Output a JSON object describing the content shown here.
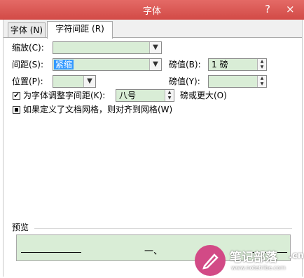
{
  "window": {
    "title": "字体",
    "help": "?",
    "close": "×"
  },
  "tabs": [
    {
      "label": "字体 (N)"
    },
    {
      "label": "字符间距 (R)"
    }
  ],
  "scale": {
    "label": "缩放(C):",
    "value": ""
  },
  "spacing": {
    "label": "间距(S):",
    "value": "紧缩",
    "by_label": "磅值(B):",
    "by_value": "1 磅"
  },
  "position": {
    "label": "位置(P):",
    "value": "",
    "by_label": "磅值(Y):",
    "by_value": ""
  },
  "kerning": {
    "label": "为字体调整字间距(K):",
    "value": "八号",
    "suffix": "磅或更大(O)",
    "checked": true
  },
  "grid": {
    "label": "如果定义了文档网格，则对齐到网格(W)",
    "state": "indeterminate"
  },
  "preview": {
    "label": "预览",
    "text": "一、"
  },
  "watermark": {
    "text": "笔记部落",
    "url": "www.notetribe.com",
    "cn": ".cn"
  },
  "colors": {
    "titlebar": "#d24a46",
    "field_bg": "#d9edd6",
    "selection": "#3399ff",
    "watermark": "#d24a86"
  }
}
